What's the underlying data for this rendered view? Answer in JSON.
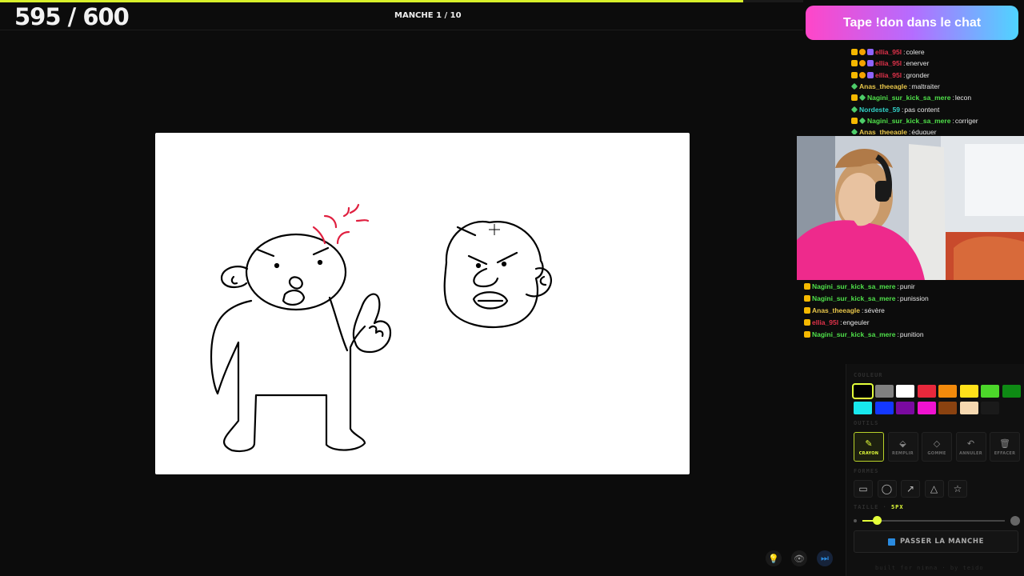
{
  "progress": {
    "fraction": 0.925
  },
  "score": "595 / 600",
  "round": "MANCHE 1 / 10",
  "don_banner": "Tape !don dans le chat",
  "chat_top": [
    {
      "badges": [
        "crown",
        "coin",
        "gem"
      ],
      "user": "ellia_95l",
      "color": "#e0324a",
      "text": "colere"
    },
    {
      "badges": [
        "crown",
        "coin",
        "gem"
      ],
      "user": "ellia_95l",
      "color": "#e0324a",
      "text": "enerver"
    },
    {
      "badges": [
        "crown",
        "coin",
        "gem"
      ],
      "user": "ellia_95l",
      "color": "#e0324a",
      "text": "gronder"
    },
    {
      "badges": [
        "green"
      ],
      "user": "Anas_theeagle",
      "color": "#e8c64a",
      "text": "maltraiter"
    },
    {
      "badges": [
        "crown",
        "green"
      ],
      "user": "Nagini_sur_kick_sa_mere",
      "color": "#4fe04a",
      "text": "lecon"
    },
    {
      "badges": [
        "green"
      ],
      "user": "Nordeste_59",
      "color": "#32d2c8",
      "text": "pas content"
    },
    {
      "badges": [
        "crown",
        "green"
      ],
      "user": "Nagini_sur_kick_sa_mere",
      "color": "#4fe04a",
      "text": "corriger"
    },
    {
      "badges": [
        "green"
      ],
      "user": "Anas_theeagle",
      "color": "#e8c64a",
      "text": "éduquer"
    }
  ],
  "chat_bottom": [
    {
      "user": "Nagini_sur_kick_sa_mere",
      "color": "#4fe04a",
      "text": "punir"
    },
    {
      "user": "Nagini_sur_kick_sa_mere",
      "color": "#4fe04a",
      "text": "punission"
    },
    {
      "user": "Anas_theeagle",
      "color": "#e8c64a",
      "text": "sévère"
    },
    {
      "user": "ellia_95l",
      "color": "#e0324a",
      "text": "engeuler"
    },
    {
      "user": "Nagini_sur_kick_sa_mere",
      "color": "#4fe04a",
      "text": "punition"
    }
  ],
  "panel": {
    "colors_label": "COULEUR",
    "tools_label": "OUTILS",
    "shapes_label": "FORMES",
    "size_label": "TAILLE",
    "size_value": "5PX",
    "size_fraction": 0.1,
    "colors": [
      "#000000",
      "#808080",
      "#ffffff",
      "#e8283c",
      "#f28a0c",
      "#ffe11a",
      "#4cd62a",
      "#0e8a14",
      "#18e8ee",
      "#1438ff",
      "#7a0aa0",
      "#f012d0",
      "#8a4210",
      "#f5d8b0",
      "#1a1a1a"
    ],
    "selected_color": 0,
    "tools": [
      {
        "icon": "pencil-icon",
        "glyph": "✎",
        "label": "CRAYON",
        "active": true
      },
      {
        "icon": "fill-bucket-icon",
        "glyph": "⬙",
        "label": "REMPLIR",
        "active": false
      },
      {
        "icon": "eraser-icon",
        "glyph": "◇",
        "label": "GOMME",
        "active": false
      },
      {
        "icon": "undo-icon",
        "glyph": "↶",
        "label": "ANNULER",
        "active": false
      },
      {
        "icon": "trash-icon",
        "glyph": "🗑",
        "label": "EFFACER",
        "active": false
      }
    ],
    "shapes": [
      {
        "icon": "rectangle-icon",
        "glyph": "▭"
      },
      {
        "icon": "ellipse-icon",
        "glyph": "◯"
      },
      {
        "icon": "arrow-icon",
        "glyph": "↗"
      },
      {
        "icon": "triangle-icon",
        "glyph": "△"
      },
      {
        "icon": "star-icon",
        "glyph": "☆"
      }
    ],
    "pass_button": "PASSER LA MANCHE",
    "footer": "built for nimna · by teido"
  },
  "bottom_icons": [
    {
      "icon": "lightbulb-icon",
      "glyph": "💡",
      "color": "#f5c400"
    },
    {
      "icon": "eye-icon",
      "glyph": "👁",
      "color": "#888888"
    },
    {
      "icon": "skip-icon",
      "glyph": "⏭",
      "color": "#2a8be0"
    }
  ]
}
